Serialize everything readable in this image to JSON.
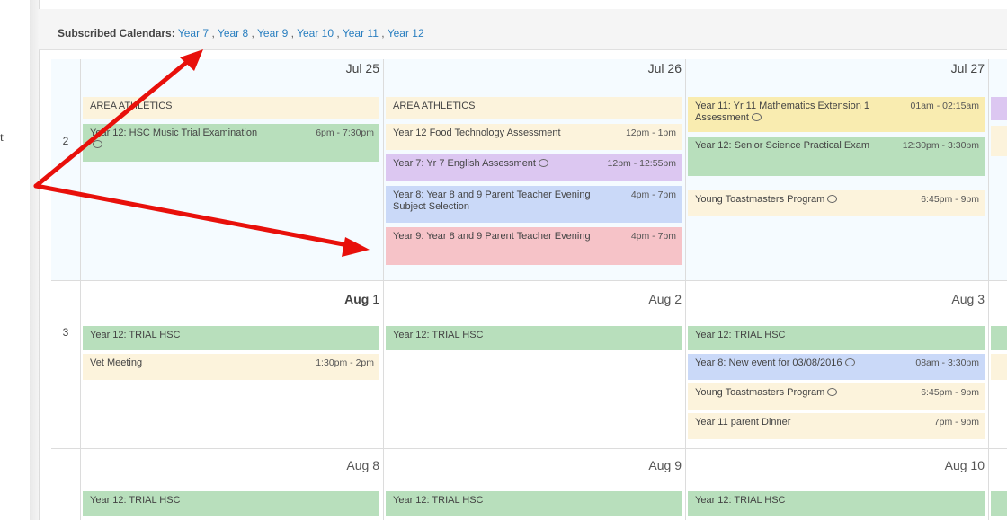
{
  "left_text": "t",
  "subscribed": {
    "label": "Subscribed Calendars:",
    "links": [
      "Year 7",
      "Year 8",
      "Year 9",
      "Year 10",
      "Year 11",
      "Year 12"
    ],
    "separator": ","
  },
  "colors": {
    "general": "#fcf3dc",
    "year12": "#b8dfbc",
    "year7": "#dcc7f1",
    "year8": "#cad9f8",
    "year9": "#f6c3c8",
    "year11": "#f9ecb0",
    "link": "#2a7fc0",
    "annotation_arrow": "#e8100b"
  },
  "weeks": [
    {
      "number": "2",
      "days": [
        {
          "date": "Jul 25",
          "events": [
            {
              "title": "AREA ATHLETICS",
              "time": ""
            },
            {
              "title": "Year 12: HSC Music Trial Examination",
              "time": "6pm - 7:30pm"
            }
          ]
        },
        {
          "date": "Jul 26",
          "events": [
            {
              "title": "AREA ATHLETICS",
              "time": ""
            },
            {
              "title": "Year 12 Food Technology Assessment",
              "time": "12pm - 1pm"
            },
            {
              "title": "Year 7: Yr 7 English Assessment",
              "time": "12pm - 12:55pm"
            },
            {
              "title": "Year 8: Year 8 and 9 Parent Teacher Evening Subject Selection",
              "time": "4pm - 7pm"
            },
            {
              "title": "Year 9: Year 8 and 9 Parent Teacher Evening",
              "time": "4pm - 7pm"
            }
          ]
        },
        {
          "date": "Jul 27",
          "events": [
            {
              "title": "Year 11: Yr 11 Mathematics Extension 1 Assessment",
              "time": "01am - 02:15am"
            },
            {
              "title": "Year 12: Senior Science Practical Exam",
              "time": "12:30pm - 3:30pm"
            },
            {
              "title": "Young Toastmasters Program",
              "time": "6:45pm - 9pm"
            }
          ]
        }
      ]
    },
    {
      "number": "3",
      "days": [
        {
          "date_prefix": "Aug ",
          "date_num": "1",
          "events": [
            {
              "title": "Year 12: TRIAL HSC",
              "time": ""
            },
            {
              "title": "Vet Meeting",
              "time": "1:30pm - 2pm"
            }
          ]
        },
        {
          "date": "Aug 2",
          "events": [
            {
              "title": "Year 12: TRIAL HSC",
              "time": ""
            }
          ]
        },
        {
          "date": "Aug 3",
          "events": [
            {
              "title": "Year 12: TRIAL HSC",
              "time": ""
            },
            {
              "title": "Year 8: New event for 03/08/2016",
              "time": "08am - 3:30pm"
            },
            {
              "title": "Young Toastmasters Program",
              "time": "6:45pm - 9pm"
            },
            {
              "title": "Year 11 parent Dinner",
              "time": "7pm - 9pm"
            }
          ]
        }
      ]
    },
    {
      "number": "",
      "days": [
        {
          "date": "Aug 8",
          "events": [
            {
              "title": "Year 12: TRIAL HSC",
              "time": ""
            }
          ]
        },
        {
          "date": "Aug 9",
          "events": [
            {
              "title": "Year 12: TRIAL HSC",
              "time": ""
            }
          ]
        },
        {
          "date": "Aug 10",
          "events": [
            {
              "title": "Year 12: TRIAL HSC",
              "time": ""
            }
          ]
        }
      ]
    }
  ]
}
